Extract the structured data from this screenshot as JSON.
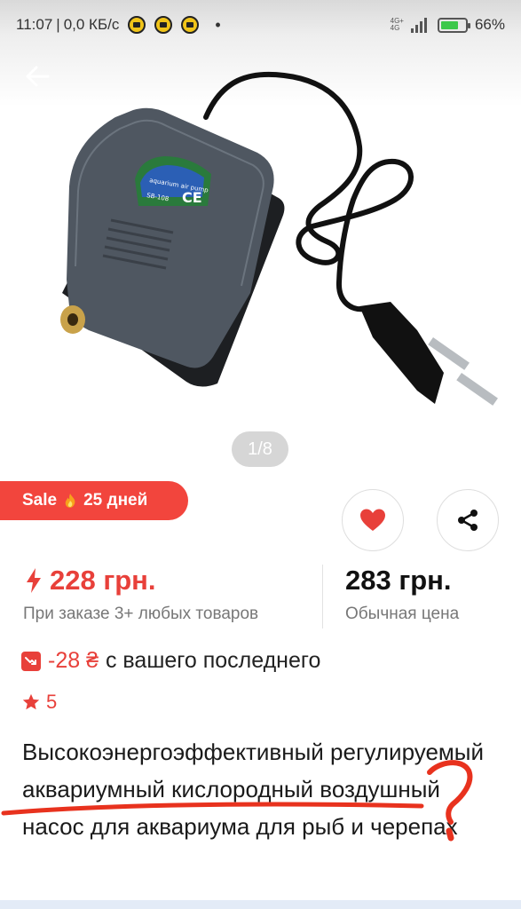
{
  "status_bar": {
    "time": "11:07",
    "speed": "0,0 КБ/с",
    "network_top": "4G+",
    "network_bottom": "4G",
    "battery_percent": "66%",
    "battery_level": 0.66
  },
  "gallery": {
    "counter": "1/8",
    "current_image": 1,
    "total_images": 8
  },
  "sale_badge": {
    "label": "Sale",
    "days": "25 дней"
  },
  "actions": {
    "favorite_icon": "heart-icon",
    "share_icon": "share-icon",
    "accent_color": "#e8403a"
  },
  "prices": {
    "promo_price": "228 грн.",
    "promo_note": "При заказе 3+ любых товаров",
    "regular_price": "283 грн.",
    "regular_note": "Обычная цена"
  },
  "discount": {
    "amount": "-28 ₴",
    "text": "с вашего последнего"
  },
  "rating": {
    "value": "5"
  },
  "product": {
    "title": "Высокоэнергоэффективный регулируемый аквариумный кислородный воздушный насос для аквариума для рыб и черепах",
    "label_brand": "aquarium air pump",
    "label_model": "SB-108",
    "label_mark": "CE"
  },
  "annotation": {
    "mark": "?",
    "color": "#e8321e"
  }
}
